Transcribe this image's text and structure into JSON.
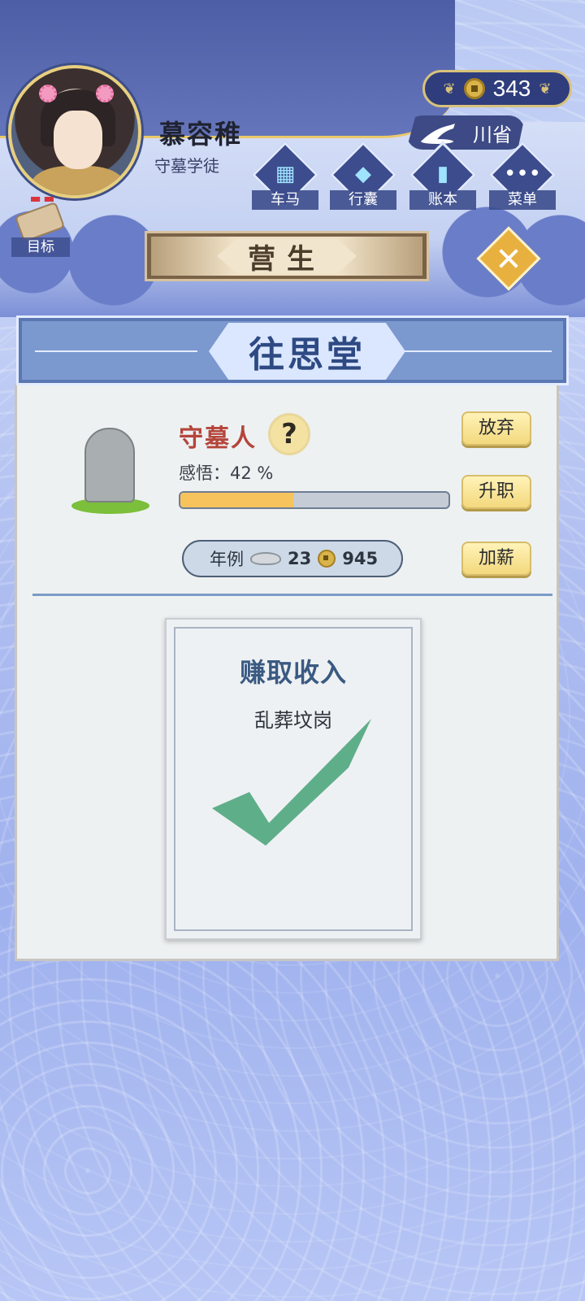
{
  "player": {
    "name": "慕容稚",
    "title": "守墓学徒"
  },
  "currency": {
    "coins": "343"
  },
  "region": {
    "label": "川省"
  },
  "nav": {
    "items": [
      {
        "label": "车马",
        "icon": "carriage-icon"
      },
      {
        "label": "行囊",
        "icon": "bag-icon"
      },
      {
        "label": "账本",
        "icon": "ledger-icon"
      },
      {
        "label": "菜单",
        "icon": "menu-dots-icon"
      }
    ],
    "goal_label": "目标"
  },
  "section": {
    "title": "营生"
  },
  "workplace": {
    "name": "往思堂"
  },
  "job": {
    "name": "守墓人",
    "insight_text": "感悟：42 %",
    "insight_percent": 42,
    "actions": {
      "abandon": "放弃",
      "promote": "升职",
      "raise": "加薪"
    },
    "salary_label": "年例",
    "salary_silver": "23",
    "salary_coins": "945"
  },
  "income_card": {
    "title": "赚取收入",
    "location": "乱葬坟岗",
    "status_icon": "checkmark-icon"
  },
  "colors": {
    "accent_red": "#b4453b",
    "check_green": "#5fae8a",
    "progress_fill": "#f7c35d"
  }
}
